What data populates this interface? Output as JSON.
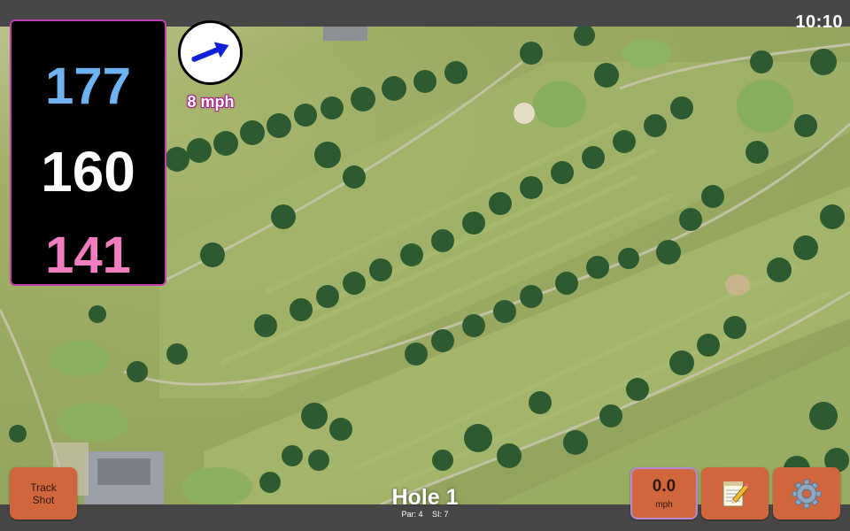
{
  "status_bar": {
    "time": "10:10"
  },
  "distances": {
    "back": "177",
    "middle": "160",
    "front": "141"
  },
  "wind": {
    "speed_label": "8 mph",
    "direction_icon": "arrow-icon"
  },
  "hole": {
    "title": "Hole 1",
    "par_label": "Par: 4",
    "si_label": "SI: 7"
  },
  "buttons": {
    "track_shot_line1": "Track",
    "track_shot_line2": "Shot",
    "speed_value": "0.0",
    "speed_unit": "mph",
    "notes_icon": "notepad-icon",
    "settings_icon": "gear-icon"
  },
  "colors": {
    "back_distance": "#6fb2f2",
    "middle_distance": "#ffffff",
    "front_distance": "#f27cc0",
    "button_bg": "#d1653c",
    "panel_border": "#c040b0"
  }
}
